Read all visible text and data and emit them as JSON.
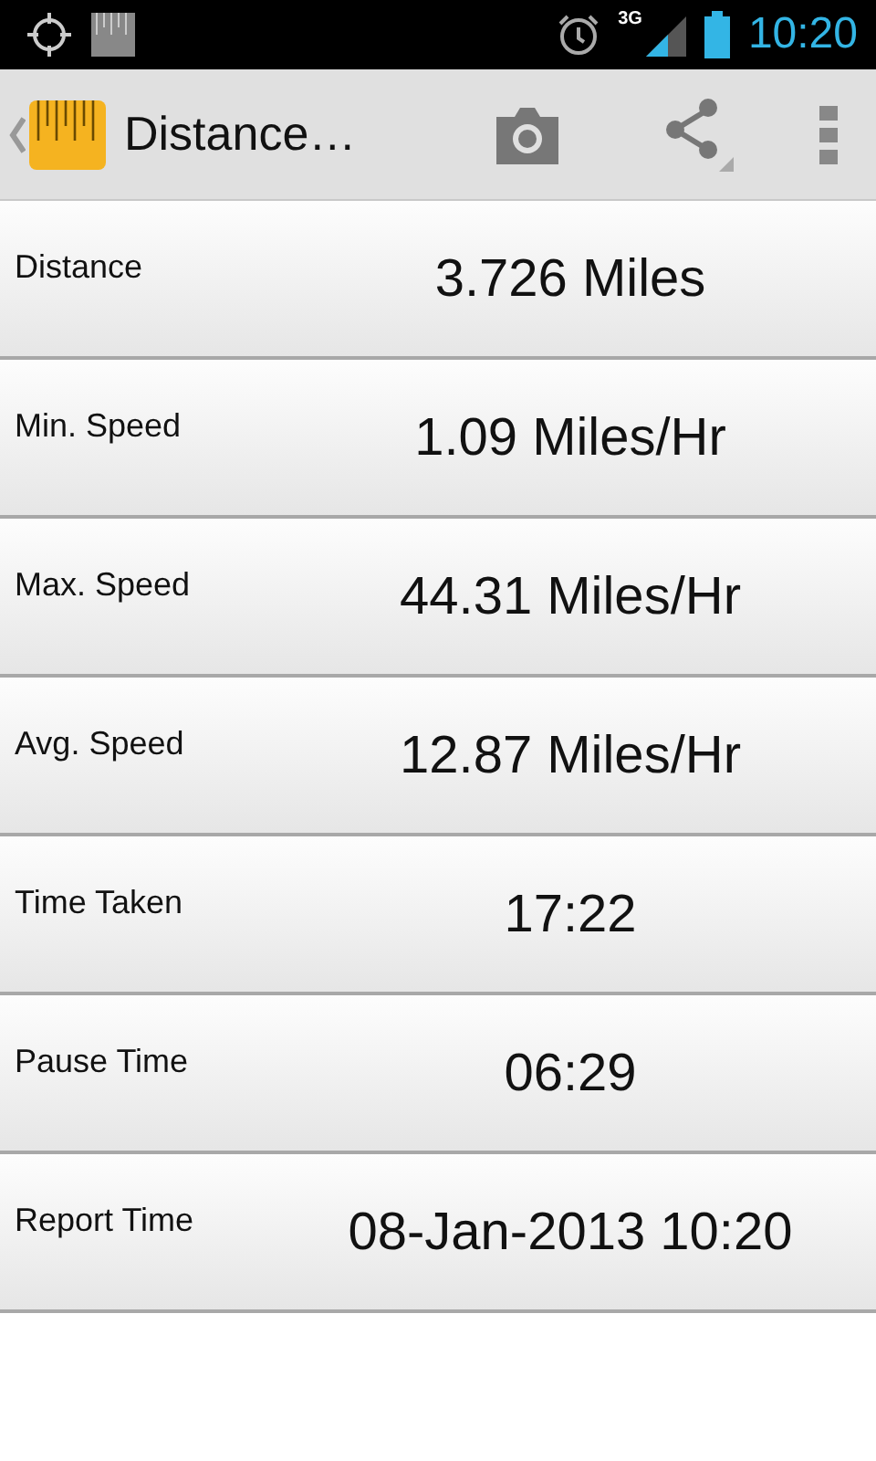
{
  "status_bar": {
    "time": "10:20",
    "network": "3G"
  },
  "action_bar": {
    "title": "Distance…"
  },
  "rows": [
    {
      "label": "Distance",
      "value": "3.726 Miles"
    },
    {
      "label": "Min. Speed",
      "value": "1.09 Miles/Hr"
    },
    {
      "label": "Max. Speed",
      "value": "44.31 Miles/Hr"
    },
    {
      "label": "Avg. Speed",
      "value": "12.87 Miles/Hr"
    },
    {
      "label": "Time Taken",
      "value": "17:22"
    },
    {
      "label": "Pause Time",
      "value": "06:29"
    },
    {
      "label": "Report Time",
      "value": "08-Jan-2013 10:20"
    }
  ]
}
